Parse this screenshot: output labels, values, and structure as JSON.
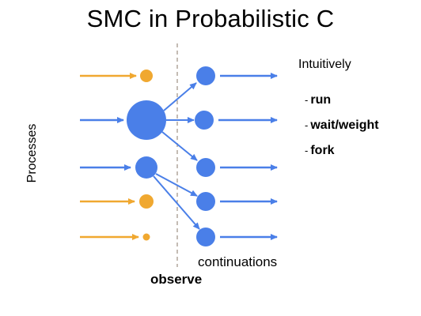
{
  "title": "SMC in Probabilistic C",
  "side_label": "Processes",
  "observe_label": "observe",
  "continuations_label": "continuations",
  "intuitively_label": "Intuitively",
  "operations": [
    {
      "dash": "-",
      "label": "run"
    },
    {
      "dash": "-",
      "label": "wait/weight"
    },
    {
      "dash": "-",
      "label": "fork"
    }
  ],
  "colors": {
    "orange": "#F0A830",
    "blue": "#4A7FE8",
    "divider": "#8a7a6a"
  }
}
